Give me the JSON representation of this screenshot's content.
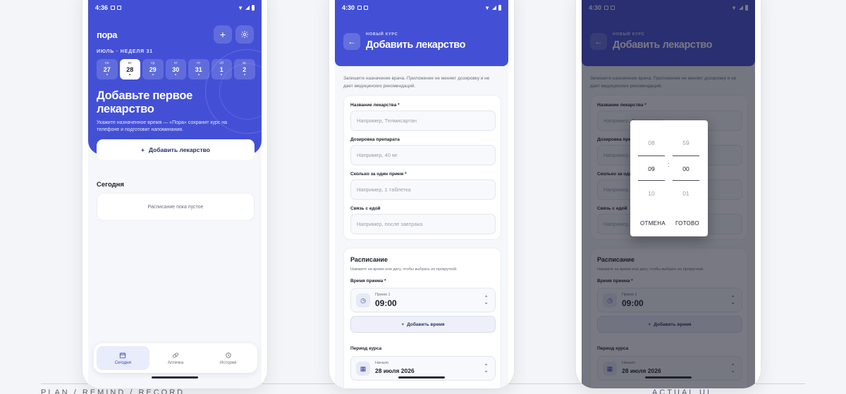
{
  "footer": {
    "left": "PLAN / REMIND / RECORD",
    "right": "ACTUAL UI"
  },
  "phone1": {
    "status": {
      "time": "4:36"
    },
    "logo": "пора",
    "header_add_icon": "plus-icon",
    "header_settings_icon": "gear-icon",
    "week_label": "ИЮЛЬ · НЕДЕЛЯ 31",
    "days": [
      {
        "name": "пн",
        "date": "27"
      },
      {
        "name": "вт",
        "date": "28"
      },
      {
        "name": "ср",
        "date": "29"
      },
      {
        "name": "чт",
        "date": "30"
      },
      {
        "name": "пт",
        "date": "31"
      },
      {
        "name": "сб",
        "date": "1"
      },
      {
        "name": "вс",
        "date": "2"
      }
    ],
    "selected_day_index": 1,
    "hero_title": "Добавьте первое лекарство",
    "hero_desc": "Укажите назначенное время — «Пора» сохранит курс на телефоне и подготовит напоминания.",
    "add_button": "Добавить лекарство",
    "today_heading": "Сегодня",
    "empty_text": "Расписание пока пустое",
    "tabs": [
      {
        "label": "Сегодня",
        "icon": "calendar-icon",
        "active": true
      },
      {
        "label": "Аптечка",
        "icon": "pill-icon",
        "active": false
      },
      {
        "label": "История",
        "icon": "history-icon",
        "active": false
      }
    ]
  },
  "form": {
    "status": {
      "time": "4:30"
    },
    "subtitle": "НОВЫЙ КУРС",
    "title": "Добавить лекарство",
    "note": "Запишите назначение врача. Приложение не меняет дозировку и не дает медицинских рекомендаций.",
    "fields": [
      {
        "label": "Название лекарства *",
        "placeholder": "Например, Телмисартан"
      },
      {
        "label": "Дозировка препарата",
        "placeholder": "Например, 40 мг"
      },
      {
        "label": "Сколько за один прием *",
        "placeholder": "Например, 1 таблетка"
      },
      {
        "label": "Связь с едой",
        "placeholder": "Например, после завтрака"
      }
    ],
    "schedule": {
      "title": "Расписание",
      "hint": "Нажмите на время или дату, чтобы выбрать их прокруткой.",
      "time_label": "Время приема *",
      "dose_small": "Прием 1",
      "dose_time": "09:00",
      "add_time": "Добавить время",
      "period_label": "Период курса",
      "start_small": "Начало",
      "start_date": "28 июля 2026"
    }
  },
  "picker": {
    "hours": [
      "08",
      "09",
      "10"
    ],
    "minutes": [
      "59",
      "00",
      "01"
    ],
    "colon": ":",
    "cancel": "ОТМЕНА",
    "done": "ГОТОВО"
  },
  "colors": {
    "accent": "#4350d6",
    "background": "#f6f7fb"
  }
}
